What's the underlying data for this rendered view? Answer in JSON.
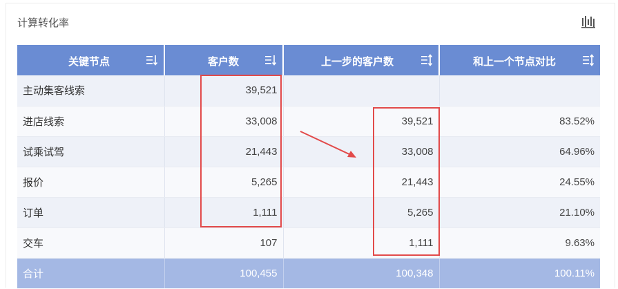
{
  "card": {
    "title": "计算转化率"
  },
  "table": {
    "headers": [
      "关键节点",
      "客户数",
      "上一步的客户数",
      "和上一个节点对比"
    ],
    "rows": [
      {
        "node": "主动集客线索",
        "customers": "39,521",
        "prev_customers": "",
        "ratio": ""
      },
      {
        "node": "进店线索",
        "customers": "33,008",
        "prev_customers": "39,521",
        "ratio": "83.52%"
      },
      {
        "node": "试乘试驾",
        "customers": "21,443",
        "prev_customers": "33,008",
        "ratio": "64.96%"
      },
      {
        "node": "报价",
        "customers": "5,265",
        "prev_customers": "21,443",
        "ratio": "24.55%"
      },
      {
        "node": "订单",
        "customers": "1,111",
        "prev_customers": "5,265",
        "ratio": "21.10%"
      },
      {
        "node": "交车",
        "customers": "107",
        "prev_customers": "1,111",
        "ratio": "9.63%"
      }
    ],
    "total": {
      "node": "合计",
      "customers": "100,455",
      "prev_customers": "100,348",
      "ratio": "100.11%"
    }
  },
  "icons": {
    "chart_toggle": "bar-chart-icon",
    "sort": "sort-icon",
    "arrow": "red-arrow-annotation"
  },
  "colors": {
    "header_bg": "#6a8cd3",
    "total_bg": "#a4b8e4",
    "highlight": "#e24a4a"
  }
}
